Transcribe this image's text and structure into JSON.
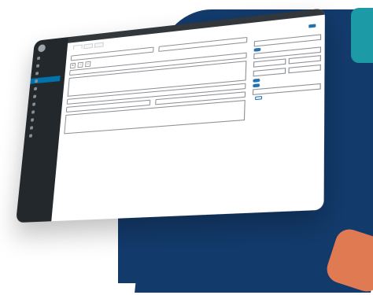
{
  "colors": {
    "background_shape": "#123a6b",
    "accent_orange": "#e07a52",
    "accent_teal": "#1c9aa6",
    "sidebar": "#23282d",
    "primary": "#2271b1"
  },
  "tabs": [
    "",
    "",
    ""
  ],
  "sidebar": {
    "items": [
      "",
      "",
      "",
      "",
      "",
      "",
      "",
      "",
      "",
      "",
      ""
    ]
  },
  "form": {
    "fields": [
      "",
      "",
      "",
      "",
      "",
      "",
      ""
    ]
  },
  "right_panel": {
    "publish_label": "",
    "publish_button": "",
    "texts": [
      "",
      "",
      "",
      "",
      "",
      "",
      "",
      "",
      "",
      "",
      "",
      "",
      ""
    ]
  }
}
